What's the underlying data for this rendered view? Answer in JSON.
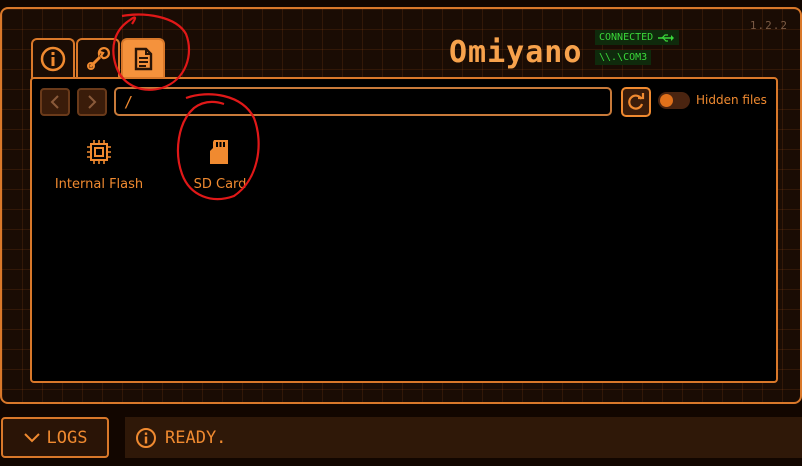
{
  "app": {
    "version": "1.2.2",
    "name": "Omiyano",
    "connection": {
      "status": "CONNECTED",
      "port": "\\\\.\\COM3",
      "color": "#3ad83a"
    },
    "accent": "#f08a30"
  },
  "tabs": [
    {
      "id": "info",
      "icon": "info-icon",
      "active": false
    },
    {
      "id": "tools",
      "icon": "wrench-icon",
      "active": false
    },
    {
      "id": "files",
      "icon": "document-icon",
      "active": true
    }
  ],
  "browser": {
    "path": "/",
    "hidden_files": {
      "label": "Hidden files",
      "enabled": false
    },
    "drives": [
      {
        "label": "Internal Flash",
        "icon": "chip-icon"
      },
      {
        "label": "SD Card",
        "icon": "sd-card-icon"
      }
    ]
  },
  "footer": {
    "logs_label": "LOGS",
    "status_text": "READY."
  }
}
